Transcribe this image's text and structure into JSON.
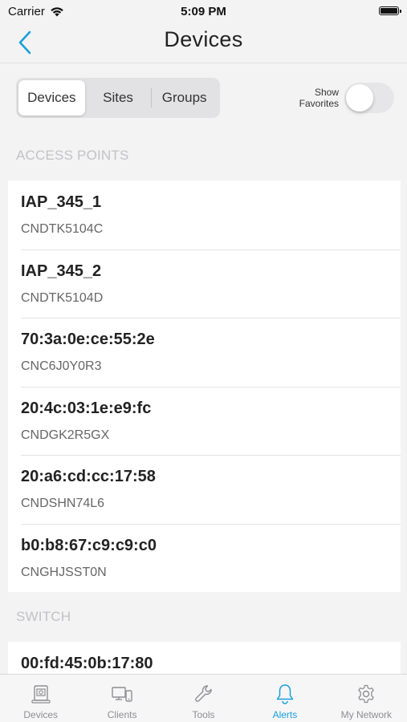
{
  "status_bar": {
    "carrier": "Carrier",
    "time": "5:09 PM"
  },
  "nav": {
    "title": "Devices",
    "back_icon": "chevron-left-icon"
  },
  "segments": [
    {
      "label": "Devices",
      "selected": true
    },
    {
      "label": "Sites",
      "selected": false
    },
    {
      "label": "Groups",
      "selected": false
    }
  ],
  "favorites_toggle": {
    "label_line1": "Show",
    "label_line2": "Favorites",
    "on": false
  },
  "sections": {
    "access_points": "ACCESS POINTS",
    "switch": "SWITCH"
  },
  "access_points": [
    {
      "name": "IAP_345_1",
      "serial": "CNDTK5104C"
    },
    {
      "name": "IAP_345_2",
      "serial": "CNDTK5104D"
    },
    {
      "name": "70:3a:0e:ce:55:2e",
      "serial": "CNC6J0Y0R3"
    },
    {
      "name": "20:4c:03:1e:e9:fc",
      "serial": "CNDGK2R5GX"
    },
    {
      "name": "20:a6:cd:cc:17:58",
      "serial": "CNDSHN74L6"
    },
    {
      "name": "b0:b8:67:c9:c9:c0",
      "serial": "CNGHJSST0N"
    }
  ],
  "switches": [
    {
      "name": "00:fd:45:0b:17:80"
    }
  ],
  "tabs": [
    {
      "label": "Devices",
      "icon": "device-icon",
      "active": false
    },
    {
      "label": "Clients",
      "icon": "clients-icon",
      "active": false
    },
    {
      "label": "Tools",
      "icon": "wrench-icon",
      "active": false
    },
    {
      "label": "Alerts",
      "icon": "bell-icon",
      "active": true
    },
    {
      "label": "My Network",
      "icon": "gear-icon",
      "active": false
    }
  ],
  "colors": {
    "accent": "#1a9fd9",
    "inactive_tab": "#8e8e93",
    "background": "#f3f3f4"
  }
}
